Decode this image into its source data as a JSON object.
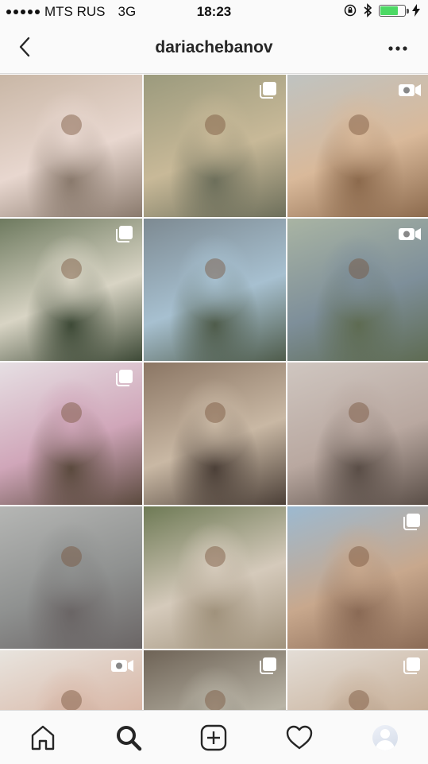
{
  "status_bar": {
    "carrier": "MTS RUS",
    "network": "3G",
    "time": "18:23",
    "battery_level": 0.75,
    "battery_color": "#4cd964"
  },
  "header": {
    "title": "dariachebanov",
    "back_icon": "chevron-left-icon",
    "more_icon": "ellipsis-icon"
  },
  "grid": {
    "tiles": [
      {
        "scene": "Street with pastel buildings, girl in pink dress",
        "badge": "none",
        "colors": [
          "#c9b7a6",
          "#e8d7cf",
          "#8a7a6d"
        ]
      },
      {
        "scene": "Girl in yellow top by water",
        "badge": "multiple",
        "colors": [
          "#9b9a7d",
          "#c8b998",
          "#6d6f5b"
        ]
      },
      {
        "scene": "Close-up portrait, curly hair",
        "badge": "video",
        "colors": [
          "#bfc3c1",
          "#d9b99a",
          "#8c6a4d"
        ]
      },
      {
        "scene": "Palm alley, flowing dress",
        "badge": "multiple",
        "colors": [
          "#6e7a5f",
          "#d8d4c4",
          "#3e4a37"
        ]
      },
      {
        "scene": "Girl in blue dress among hydrangeas",
        "badge": "none",
        "colors": [
          "#7d8a92",
          "#a7c0d0",
          "#4f5c4b"
        ]
      },
      {
        "scene": "Lake with hydrangea path",
        "badge": "video",
        "colors": [
          "#a9b4a3",
          "#7e8f9a",
          "#5e6b52"
        ]
      },
      {
        "scene": "Girl in black top, white room",
        "badge": "multiple",
        "colors": [
          "#e6dfe3",
          "#d0a6b9",
          "#5b4a3e"
        ]
      },
      {
        "scene": "Balcony with two girls",
        "badge": "none",
        "colors": [
          "#8b7664",
          "#c9b8a4",
          "#4c4038"
        ]
      },
      {
        "scene": "Girl lying on sofa",
        "badge": "none",
        "colors": [
          "#cfc6c0",
          "#b9a8a0",
          "#5a4e47"
        ]
      },
      {
        "scene": "Girl sitting on road",
        "badge": "none",
        "colors": [
          "#b5b6b4",
          "#8f9190",
          "#6a6565"
        ]
      },
      {
        "scene": "Couple lying in grass",
        "badge": "none",
        "colors": [
          "#6e7a55",
          "#d5cabb",
          "#a0927c"
        ]
      },
      {
        "scene": "City rooftops view",
        "badge": "multiple",
        "colors": [
          "#9cb9d0",
          "#c8a88d",
          "#8a6a55"
        ]
      },
      {
        "scene": "Girl with braids and flowers",
        "badge": "video",
        "colors": [
          "#e8e4de",
          "#d9b9a9",
          "#a88a7a"
        ]
      },
      {
        "scene": "Girl by window",
        "badge": "multiple",
        "colors": [
          "#6e6356",
          "#b9b4a6",
          "#3e3a34"
        ]
      },
      {
        "scene": "Girl with sunglasses in room",
        "badge": "multiple",
        "colors": [
          "#e3ddd6",
          "#c9b29c",
          "#7a6656"
        ]
      }
    ]
  },
  "bottom_nav": {
    "items": [
      {
        "icon": "home-icon"
      },
      {
        "icon": "search-icon"
      },
      {
        "icon": "add-post-icon"
      },
      {
        "icon": "heart-icon"
      },
      {
        "icon": "profile-avatar-icon"
      }
    ]
  }
}
